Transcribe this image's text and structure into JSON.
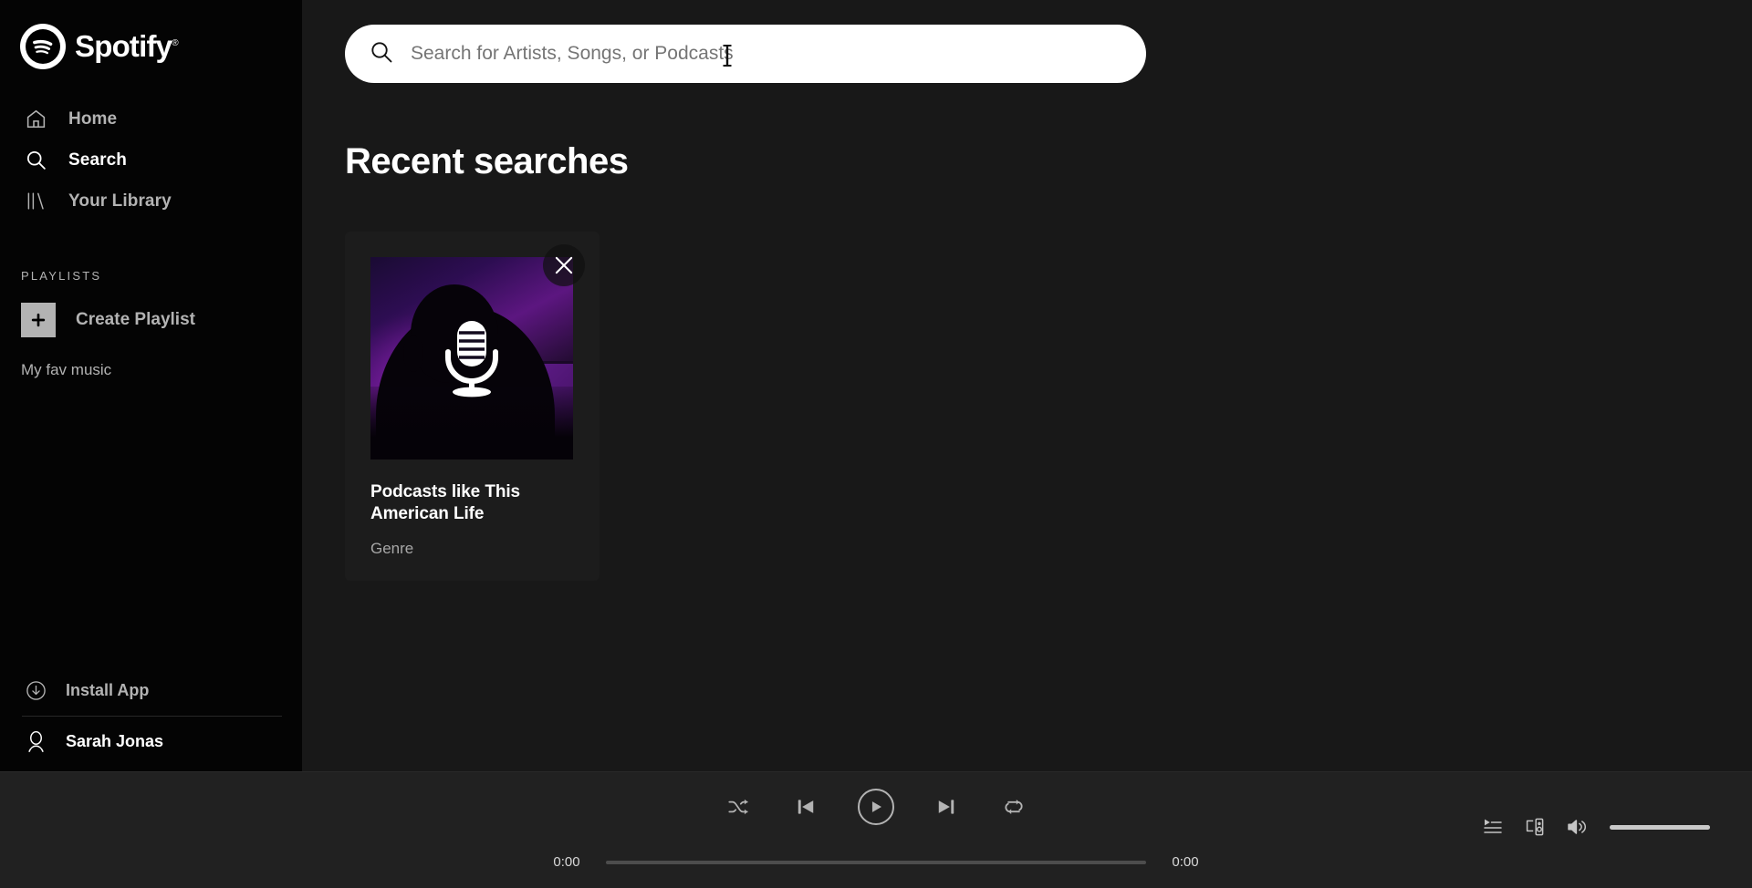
{
  "app": {
    "name": "Spotify",
    "logo_text": "Spotify",
    "logo_registered": "®"
  },
  "colors": {
    "sidebar_bg": "#040404",
    "main_bg": "#181818",
    "player_bg": "#212121",
    "card_bg": "#1c1c1c",
    "text_primary": "#ffffff",
    "text_muted": "#b3b3b3",
    "search_bg": "#ffffff",
    "search_placeholder": "#757575"
  },
  "sidebar": {
    "nav": [
      {
        "label": "Home",
        "icon": "home-icon",
        "active": false
      },
      {
        "label": "Search",
        "icon": "search-icon",
        "active": true
      },
      {
        "label": "Your Library",
        "icon": "library-icon",
        "active": false
      }
    ],
    "playlists_header": "PLAYLISTS",
    "create_playlist": {
      "label": "Create Playlist",
      "icon": "plus-icon"
    },
    "playlists": [
      {
        "name": "My fav music"
      }
    ],
    "install": {
      "label": "Install App",
      "icon": "download-circle-icon"
    },
    "user": {
      "name": "Sarah Jonas",
      "icon": "user-avatar-icon"
    }
  },
  "search": {
    "value": "",
    "placeholder": "Search for Artists, Songs, or Podcasts",
    "icon": "search-icon",
    "cursor": "text-ibeam-cursor"
  },
  "main": {
    "heading": "Recent searches",
    "cards": [
      {
        "title": "Podcasts like This American Life",
        "subtitle": "Genre",
        "art_icon": "microphone-icon",
        "close_icon": "close-x-icon"
      }
    ]
  },
  "player": {
    "controls": [
      {
        "name": "shuffle",
        "icon": "shuffle-icon"
      },
      {
        "name": "previous",
        "icon": "previous-track-icon"
      },
      {
        "name": "play",
        "icon": "play-icon"
      },
      {
        "name": "next",
        "icon": "next-track-icon"
      },
      {
        "name": "repeat",
        "icon": "repeat-icon"
      }
    ],
    "elapsed_time": "0:00",
    "total_time": "0:00",
    "progress_percent": 0,
    "volume_percent": 100,
    "right_controls": [
      {
        "name": "queue",
        "icon": "queue-icon"
      },
      {
        "name": "devices",
        "icon": "connect-device-icon"
      },
      {
        "name": "volume",
        "icon": "volume-icon"
      }
    ]
  }
}
